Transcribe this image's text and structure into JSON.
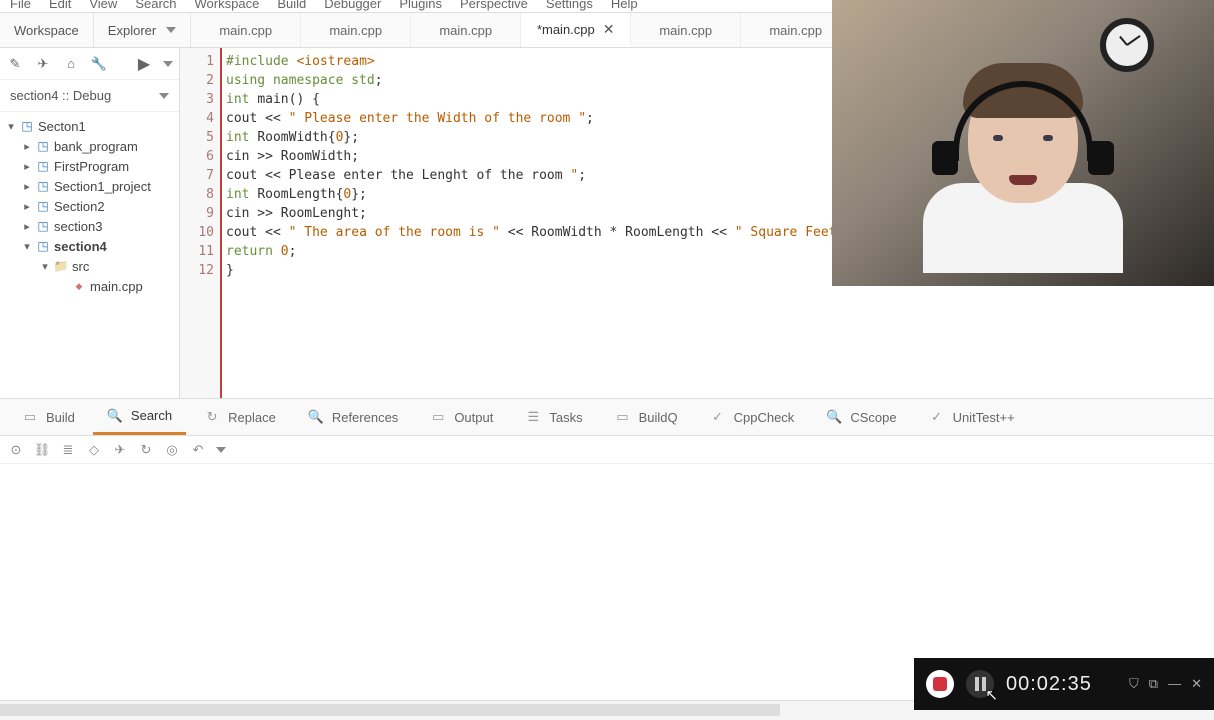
{
  "menu": [
    "File",
    "Edit",
    "View",
    "Search",
    "Workspace",
    "Build",
    "Debugger",
    "Plugins",
    "Perspective",
    "Settings",
    "Help"
  ],
  "sidebar_tabs": {
    "workspace": "Workspace",
    "explorer": "Explorer"
  },
  "editor_tabs": [
    {
      "label": "main.cpp",
      "active": false
    },
    {
      "label": "main.cpp",
      "active": false
    },
    {
      "label": "main.cpp",
      "active": false
    },
    {
      "label": "*main.cpp",
      "active": true,
      "close": true
    },
    {
      "label": "main.cpp",
      "active": false
    },
    {
      "label": "main.cpp",
      "active": false
    }
  ],
  "config": "section4 :: Debug",
  "tree": {
    "root": "Secton1",
    "children": [
      {
        "label": "bank_program",
        "type": "proj"
      },
      {
        "label": "FirstProgram",
        "type": "proj"
      },
      {
        "label": "Section1_project",
        "type": "proj"
      },
      {
        "label": "Section2",
        "type": "proj"
      },
      {
        "label": "section3",
        "type": "proj"
      },
      {
        "label": "section4",
        "type": "proj",
        "bold": true,
        "expanded": true,
        "children": [
          {
            "label": "src",
            "type": "folder",
            "expanded": true,
            "children": [
              {
                "label": "main.cpp",
                "type": "file"
              }
            ]
          }
        ]
      }
    ]
  },
  "code_lines": [
    {
      "n": 1,
      "segs": [
        [
          "kw",
          "#include "
        ],
        [
          "lib",
          "<iostream>"
        ]
      ]
    },
    {
      "n": 2,
      "segs": [
        [
          "kw",
          "using namespace "
        ],
        [
          "ty",
          "std"
        ],
        [
          "",
          ";"
        ]
      ]
    },
    {
      "n": 3,
      "segs": [
        [
          "ty",
          "int "
        ],
        [
          "",
          "main() {"
        ]
      ]
    },
    {
      "n": 4,
      "segs": [
        [
          "",
          "cout << "
        ],
        [
          "str",
          "\" Please enter the Width of the room \""
        ],
        [
          "",
          ";"
        ]
      ]
    },
    {
      "n": 5,
      "segs": [
        [
          "ty",
          "int "
        ],
        [
          "",
          "RoomWidth{"
        ],
        [
          "num",
          "0"
        ],
        [
          "",
          "};"
        ]
      ]
    },
    {
      "n": 6,
      "segs": [
        [
          "",
          "cin >> RoomWidth;"
        ]
      ]
    },
    {
      "n": 7,
      "segs": [
        [
          "",
          "cout << Please enter the Lenght of the room "
        ],
        [
          "str",
          "\""
        ],
        [
          "",
          ";"
        ]
      ]
    },
    {
      "n": 8,
      "segs": [
        [
          "ty",
          "int "
        ],
        [
          "",
          "RoomLength{"
        ],
        [
          "num",
          "0"
        ],
        [
          "",
          "};"
        ]
      ]
    },
    {
      "n": 9,
      "segs": [
        [
          "",
          "cin >> RoomLenght;"
        ]
      ]
    },
    {
      "n": 10,
      "segs": [
        [
          "",
          "cout << "
        ],
        [
          "str",
          "\" The area of the room is \""
        ],
        [
          "",
          " << RoomWidth * RoomLength << "
        ],
        [
          "str",
          "\" Square Feet \""
        ]
      ]
    },
    {
      "n": 11,
      "segs": [
        [
          "kw",
          "return "
        ],
        [
          "num",
          "0"
        ],
        [
          "",
          ";"
        ]
      ]
    },
    {
      "n": 12,
      "segs": [
        [
          "",
          "}"
        ]
      ]
    }
  ],
  "bottom_tabs": [
    {
      "label": "Build",
      "icon": "▭"
    },
    {
      "label": "Search",
      "icon": "🔍",
      "active": true
    },
    {
      "label": "Replace",
      "icon": "↻"
    },
    {
      "label": "References",
      "icon": "🔍"
    },
    {
      "label": "Output",
      "icon": "▭"
    },
    {
      "label": "Tasks",
      "icon": "☰"
    },
    {
      "label": "BuildQ",
      "icon": "▭"
    },
    {
      "label": "CppCheck",
      "icon": "✓"
    },
    {
      "label": "CScope",
      "icon": "🔍"
    },
    {
      "label": "UnitTest++",
      "icon": "✓"
    }
  ],
  "recorder": {
    "time": "00:02:35"
  }
}
